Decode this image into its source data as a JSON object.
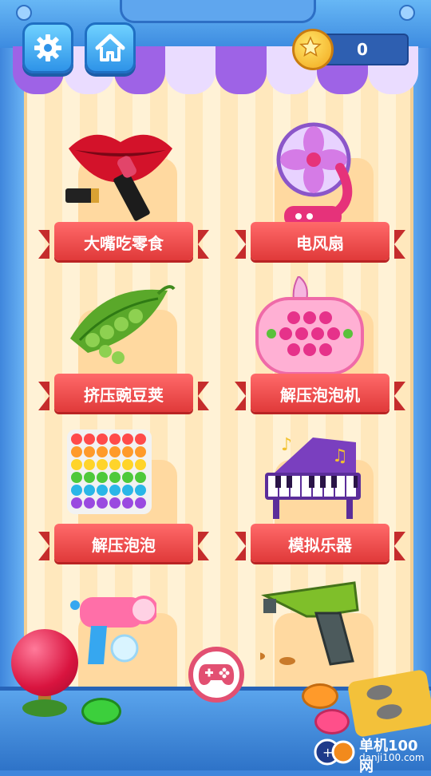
{
  "header": {
    "settings_icon": "gear-icon",
    "home_icon": "home-icon",
    "coin_icon": "star-coin-icon",
    "coins": "0"
  },
  "items": [
    {
      "label": "大嘴吃零食",
      "icon": "lips-lipstick-icon"
    },
    {
      "label": "电风扇",
      "icon": "electric-fan-icon"
    },
    {
      "label": "挤压豌豆荚",
      "icon": "pea-pod-icon"
    },
    {
      "label": "解压泡泡机",
      "icon": "pop-it-console-icon"
    },
    {
      "label": "解压泡泡",
      "icon": "rainbow-pop-it-icon"
    },
    {
      "label": "模拟乐器",
      "icon": "piano-icon"
    },
    {
      "icon": "bubble-gun-icon"
    },
    {
      "icon": "toy-pistol-icon"
    }
  ],
  "footer": {
    "game_icon": "gamepad-icon"
  },
  "watermark": {
    "name": "单机100网",
    "url": "danji100.com"
  },
  "colors": {
    "frame_blue": "#3f86dc",
    "awning_purple": "#9e63e6",
    "ribbon_red": "#e03a3a",
    "plate_orange": "#ffd9a0"
  }
}
